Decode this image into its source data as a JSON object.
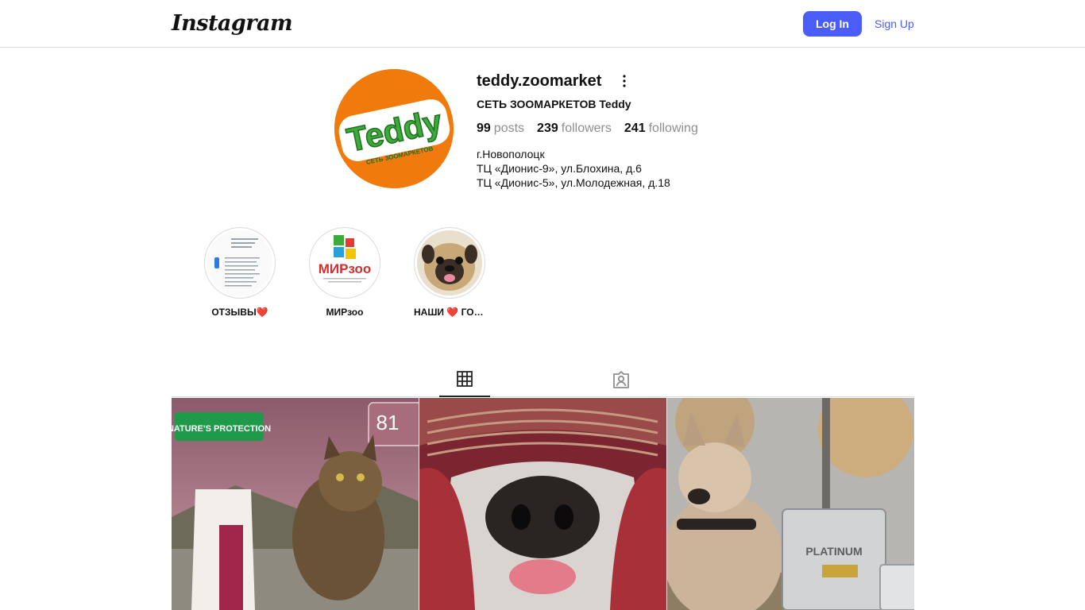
{
  "header": {
    "logo_text": "Instagram",
    "login_label": "Log In",
    "signup_label": "Sign Up"
  },
  "profile": {
    "username": "teddy.zoomarket",
    "full_name": "СЕТЬ ЗООМАРКЕТОВ Teddy",
    "avatar_logo_text": "Teddy",
    "avatar_caption": "СЕТЬ ЗООМАРКЕТОВ",
    "stats": {
      "posts_count": "99",
      "posts_label": "posts",
      "followers_count": "239",
      "followers_label": "followers",
      "following_count": "241",
      "following_label": "following"
    },
    "bio": [
      "г.Новополоцк",
      "ТЦ «Дионис-9», ул.Блохина, д.6",
      "ТЦ «Дионис-5», ул.Молодежная, д.18"
    ]
  },
  "highlights": [
    {
      "label": "ОТЗЫВЫ❤️"
    },
    {
      "label": "МИРзоо",
      "logo_text": "МИРзоо"
    },
    {
      "label": "НАШИ ❤️ ГОСТИ"
    }
  ],
  "tabs": [
    {
      "name": "posts",
      "icon": "grid-icon",
      "active": true
    },
    {
      "name": "tagged",
      "icon": "tagged-icon",
      "active": false
    }
  ],
  "posts": [
    {
      "subject": "cat-food",
      "badge": "NATURE'S PROTECTION",
      "overlay_text": "81"
    },
    {
      "subject": "dog-nose-blanket"
    },
    {
      "subject": "pitbull-food",
      "overlay_text": "PLATINUM"
    }
  ],
  "colors": {
    "accent": "#4a5df9",
    "avatar_bg": "#f07a0c",
    "border": "#dbdbdb"
  }
}
